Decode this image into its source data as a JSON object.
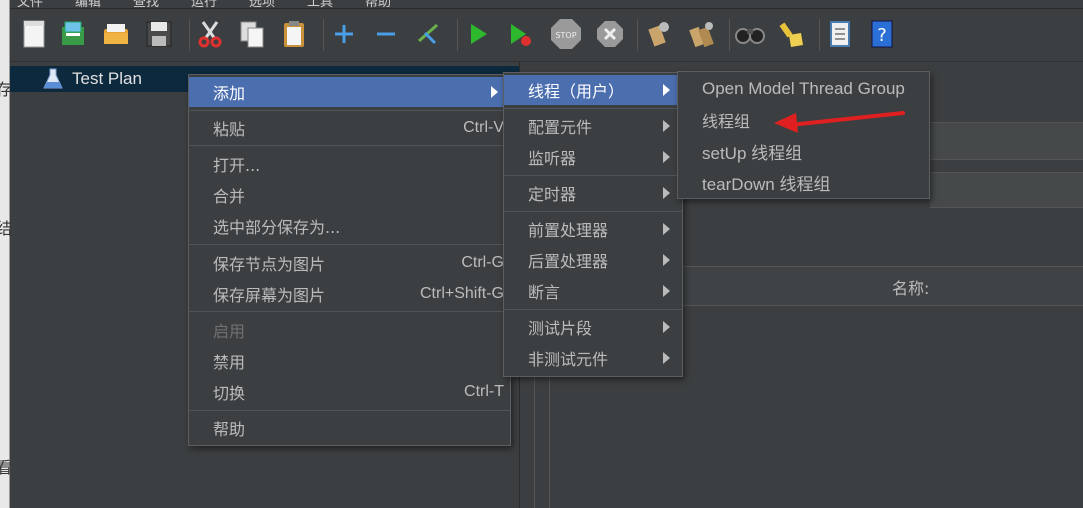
{
  "left_strip_chars": [
    "存",
    "结",
    "看"
  ],
  "menubar_items": [
    "文件",
    "编辑",
    "查找",
    "运行",
    "选项",
    "工具",
    "帮助"
  ],
  "toolbar": {
    "icons": [
      "new-icon",
      "templates-icon",
      "open-icon",
      "save-icon",
      "cut-icon",
      "copy-icon",
      "paste-icon",
      "expand-icon",
      "collapse-icon",
      "toggle-icon",
      "start-icon",
      "start-no-pause-icon",
      "stop-icon",
      "shutdown-icon",
      "clear-icon",
      "clear-all-icon",
      "search-icon",
      "reset-search-icon",
      "function-helper-icon",
      "help-icon"
    ]
  },
  "tree": {
    "root_label": "Test Plan"
  },
  "right_pane": {
    "name_label": "名称:"
  },
  "context_menu": {
    "items": [
      {
        "label": "添加",
        "shortcut": "",
        "submenu": true,
        "selected": true,
        "disabled": false
      },
      {
        "label": "粘贴",
        "shortcut": "Ctrl-V",
        "submenu": false,
        "selected": false,
        "disabled": false
      },
      {
        "label": "打开...",
        "shortcut": "",
        "submenu": false,
        "selected": false,
        "disabled": false
      },
      {
        "label": "合并",
        "shortcut": "",
        "submenu": false,
        "selected": false,
        "disabled": false
      },
      {
        "label": "选中部分保存为...",
        "shortcut": "",
        "submenu": false,
        "selected": false,
        "disabled": false
      },
      {
        "label": "保存节点为图片",
        "shortcut": "Ctrl-G",
        "submenu": false,
        "selected": false,
        "disabled": false
      },
      {
        "label": "保存屏幕为图片",
        "shortcut": "Ctrl+Shift-G",
        "submenu": false,
        "selected": false,
        "disabled": false
      },
      {
        "label": "启用",
        "shortcut": "",
        "submenu": false,
        "selected": false,
        "disabled": true
      },
      {
        "label": "禁用",
        "shortcut": "",
        "submenu": false,
        "selected": false,
        "disabled": false
      },
      {
        "label": "切换",
        "shortcut": "Ctrl-T",
        "submenu": false,
        "selected": false,
        "disabled": false
      },
      {
        "label": "帮助",
        "shortcut": "",
        "submenu": false,
        "selected": false,
        "disabled": false
      }
    ]
  },
  "add_submenu": {
    "items": [
      {
        "label": "线程（用户）",
        "selected": true
      },
      {
        "label": "配置元件",
        "selected": false
      },
      {
        "label": "监听器",
        "selected": false
      },
      {
        "label": "定时器",
        "selected": false
      },
      {
        "label": "前置处理器",
        "selected": false
      },
      {
        "label": "后置处理器",
        "selected": false
      },
      {
        "label": "断言",
        "selected": false
      },
      {
        "label": "测试片段",
        "selected": false
      },
      {
        "label": "非测试元件",
        "selected": false
      }
    ]
  },
  "threads_submenu": {
    "items": [
      {
        "label": "Open Model Thread Group"
      },
      {
        "label": "线程组"
      },
      {
        "label": "setUp 线程组"
      },
      {
        "label": "tearDown 线程组"
      }
    ]
  },
  "colors": {
    "background": "#3c3f41",
    "selection": "#4b6eaf",
    "tree_selection": "#0d293e",
    "annotation_arrow": "#e02020"
  }
}
